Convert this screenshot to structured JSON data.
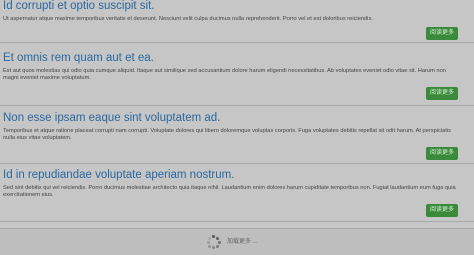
{
  "articles": [
    {
      "title": "Id corrupti et optio suscipit sit.",
      "body": "Ut aspernatur atque maxime temporibus veritatis et deserunt. Nesciunt velit culpa ducimus nulla reprehenderit. Porro vel et est doloribus reiciendis.",
      "button_label": "阅读更多"
    },
    {
      "title": "Et omnis rem quam aut et ea.",
      "body": "Est aut quos molestias qui odio quia cumque aliquid. Itaque aut similique sed accusantium dolore harum eligendi necessitatibus. Ab voluptates eveniet odio vitae sit. Harum non magni eveniet maxime voluptatum.",
      "button_label": "阅读更多"
    },
    {
      "title": "Non esse ipsam eaque sint voluptatem ad.",
      "body": "Temporibus et atque ratione placeat corrupti nam corrupti. Voluptate dolores qui libero doloremque voluptas corporis. Fuga voluptates debitis repellat sit odit harum. At perspiciatis nulla eius vitae voluptatem.",
      "button_label": "阅读更多"
    },
    {
      "title": "Id in repudiandae voluptate aperiam nostrum.",
      "body": "Sed sint debitis qui vel reiciendis. Porro ducimus molestiae architecto quia itaque nihil. Laudantium enim dolores harum cupiditate temporibus non. Fugiat laudantium eum fuga quia exercitationem eius.",
      "button_label": "阅读更多"
    }
  ],
  "footer": {
    "loading_text": "加载更多 ..."
  }
}
